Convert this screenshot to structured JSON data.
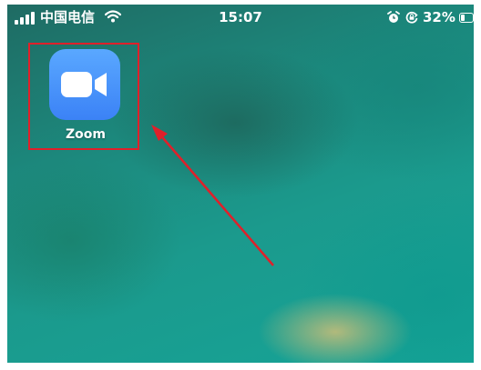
{
  "status_bar": {
    "carrier": "中国电信",
    "time": "15:07",
    "battery_percent": "32%",
    "battery_level": 0.32,
    "icons": [
      "signal-icon",
      "wifi-icon",
      "alarm-icon",
      "rotation-lock-icon",
      "battery-icon"
    ]
  },
  "home_screen": {
    "apps": [
      {
        "label": "Zoom",
        "icon": "zoom-camera-icon",
        "icon_color": "#3b82f6"
      }
    ]
  },
  "annotation": {
    "highlight_color": "#e0202a",
    "arrow_color": "#e0202a"
  }
}
